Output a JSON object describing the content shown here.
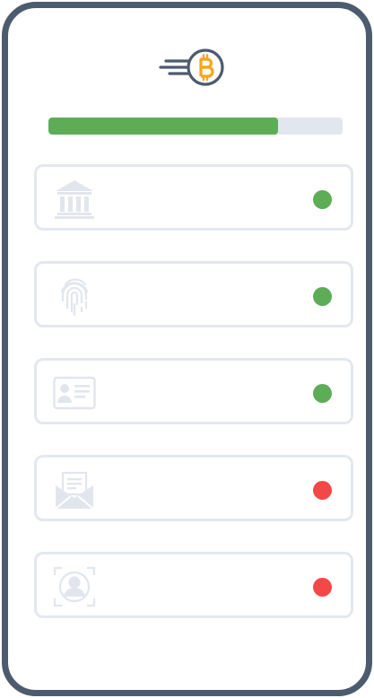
{
  "onboarding": {
    "logo_icon": "bitcoin-rocket-icon",
    "progress_fraction": 0.78,
    "colors": {
      "frame": "#4d5b6e",
      "progress_fill": "#5cad56",
      "progress_track": "#e2e7ef",
      "verified": "#5cad56",
      "pending": "#f44848",
      "icon": "#e1e6ee",
      "bitcoin": "#f7a51c"
    },
    "steps": [
      {
        "icon": "bank-icon",
        "status": "verified"
      },
      {
        "icon": "fingerprint-icon",
        "status": "verified"
      },
      {
        "icon": "id-card-icon",
        "status": "verified"
      },
      {
        "icon": "email-envelope-icon",
        "status": "pending"
      },
      {
        "icon": "face-scan-icon",
        "status": "pending"
      }
    ]
  }
}
